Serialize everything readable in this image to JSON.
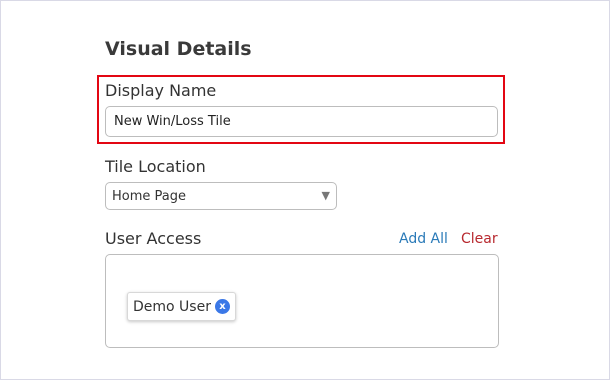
{
  "section": {
    "title": "Visual Details"
  },
  "display_name": {
    "label": "Display Name",
    "value": "New Win/Loss Tile"
  },
  "tile_location": {
    "label": "Tile Location",
    "selected": "Home Page",
    "arrow_glyph": "▼"
  },
  "user_access": {
    "label": "User Access",
    "add_all": "Add All",
    "clear": "Clear",
    "users": [
      {
        "name": "Demo User",
        "remove_glyph": "x"
      }
    ]
  },
  "colors": {
    "highlight": "#e30613",
    "link_add_all": "#2a7ab8",
    "link_clear": "#b8292f",
    "chip_remove_bg": "#3b78e7"
  },
  "icons": {
    "select_arrow": "chevron-down-icon",
    "chip_remove": "remove-icon"
  }
}
